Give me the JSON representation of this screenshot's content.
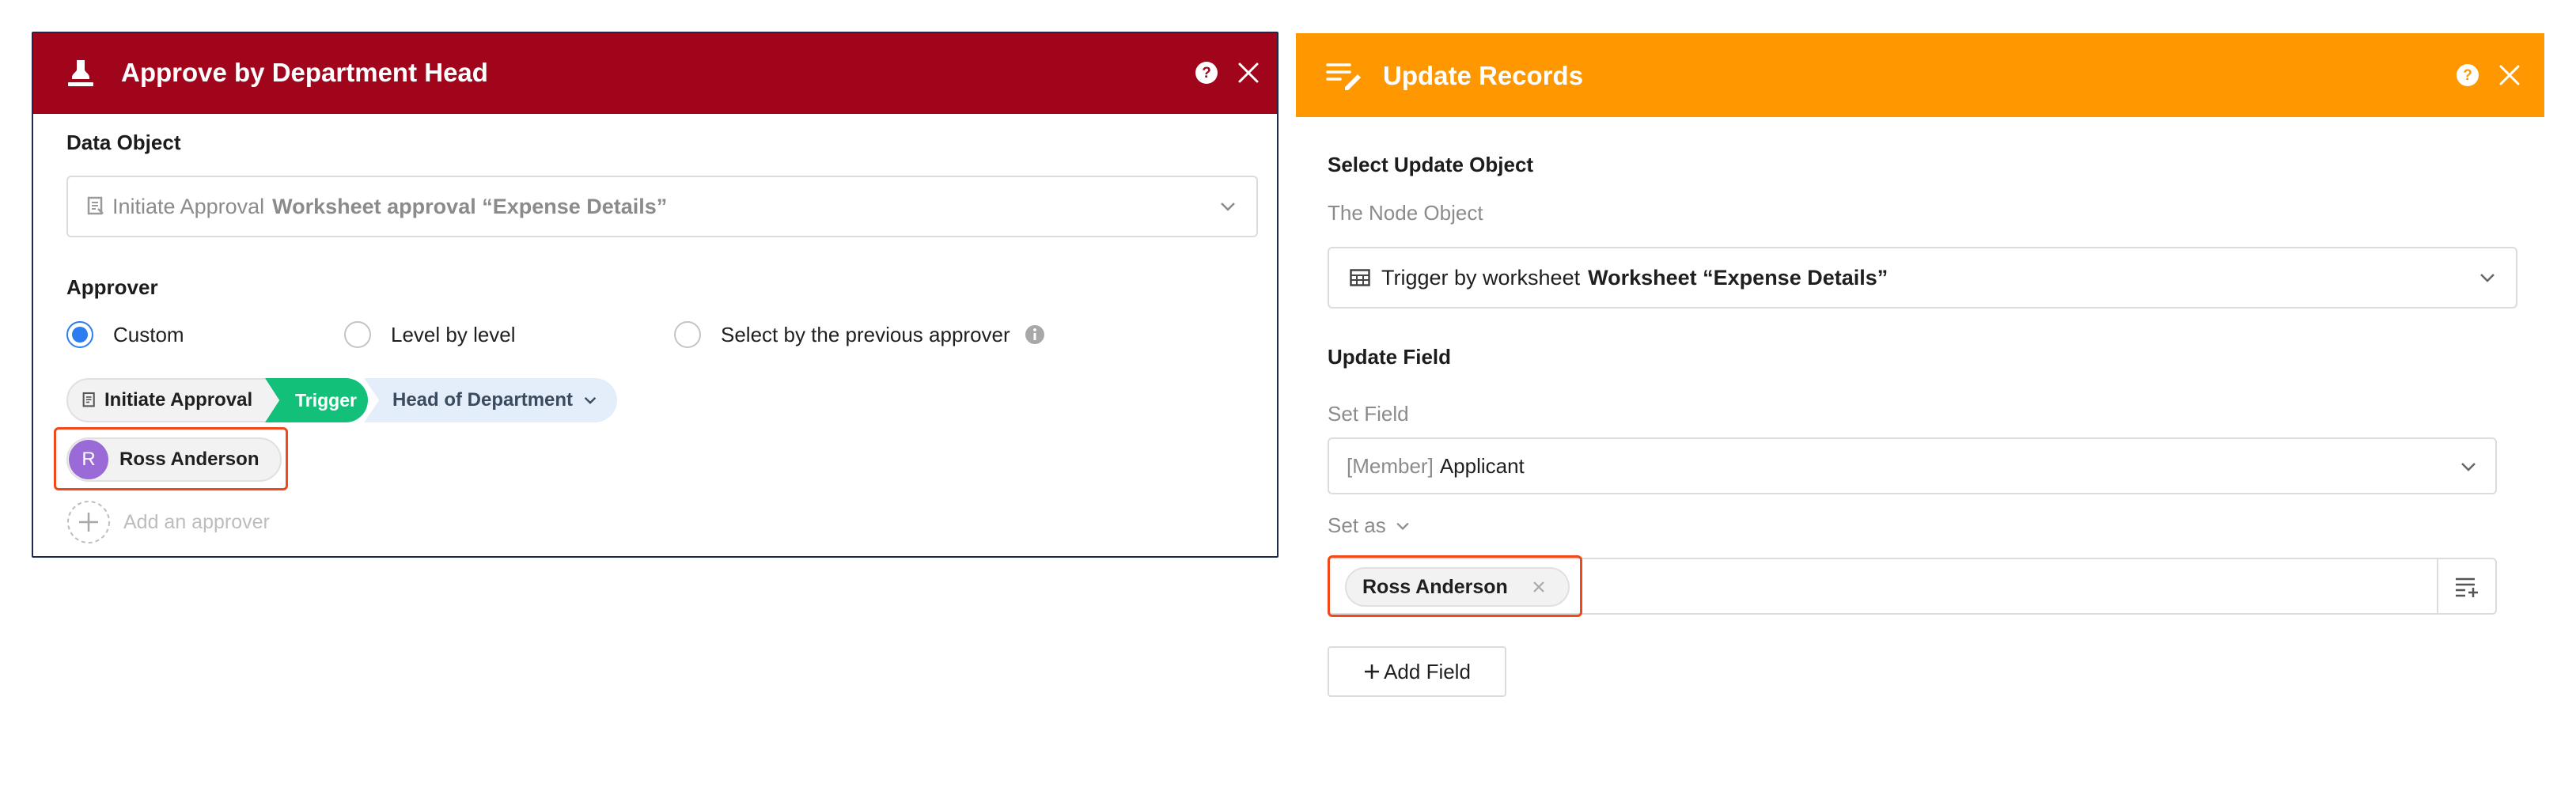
{
  "left_panel": {
    "title": "Approve by Department Head",
    "header_color": "#a0051c",
    "icons": {
      "header": "stamp-icon",
      "help": "help-circle-icon",
      "close": "close-icon"
    },
    "data_object": {
      "label": "Data Object",
      "prefix": "Initiate Approval",
      "value": "Worksheet approval “Expense Details”"
    },
    "approver": {
      "label": "Approver",
      "options": [
        "Custom",
        "Level by level",
        "Select by the previous approver"
      ],
      "selected": "Custom",
      "path": {
        "source": "Initiate Approval",
        "trigger": "Trigger",
        "field": "Head of Department"
      },
      "user": {
        "initial": "R",
        "name": "Ross Anderson",
        "avatar_color": "#9a6ad6"
      },
      "add_label": "Add an approver"
    }
  },
  "right_panel": {
    "title": "Update Records",
    "header_color": "#ff9800",
    "icons": {
      "header": "edit-list-icon",
      "help": "help-circle-icon",
      "close": "close-icon"
    },
    "select_object": {
      "label": "Select Update Object",
      "sublabel": "The Node Object",
      "prefix": "Trigger by worksheet",
      "value": "Worksheet “Expense Details”"
    },
    "update_field": {
      "label": "Update Field",
      "set_field_label": "Set Field",
      "field_type": "[Member]",
      "field_name": "Applicant",
      "set_as_label": "Set as",
      "value_chip": "Ross Anderson",
      "add_field_label": "Add Field"
    }
  },
  "colors": {
    "accent_blue": "#2c7df0",
    "trigger_green": "#12c07a",
    "highlight": "#f0481b"
  }
}
